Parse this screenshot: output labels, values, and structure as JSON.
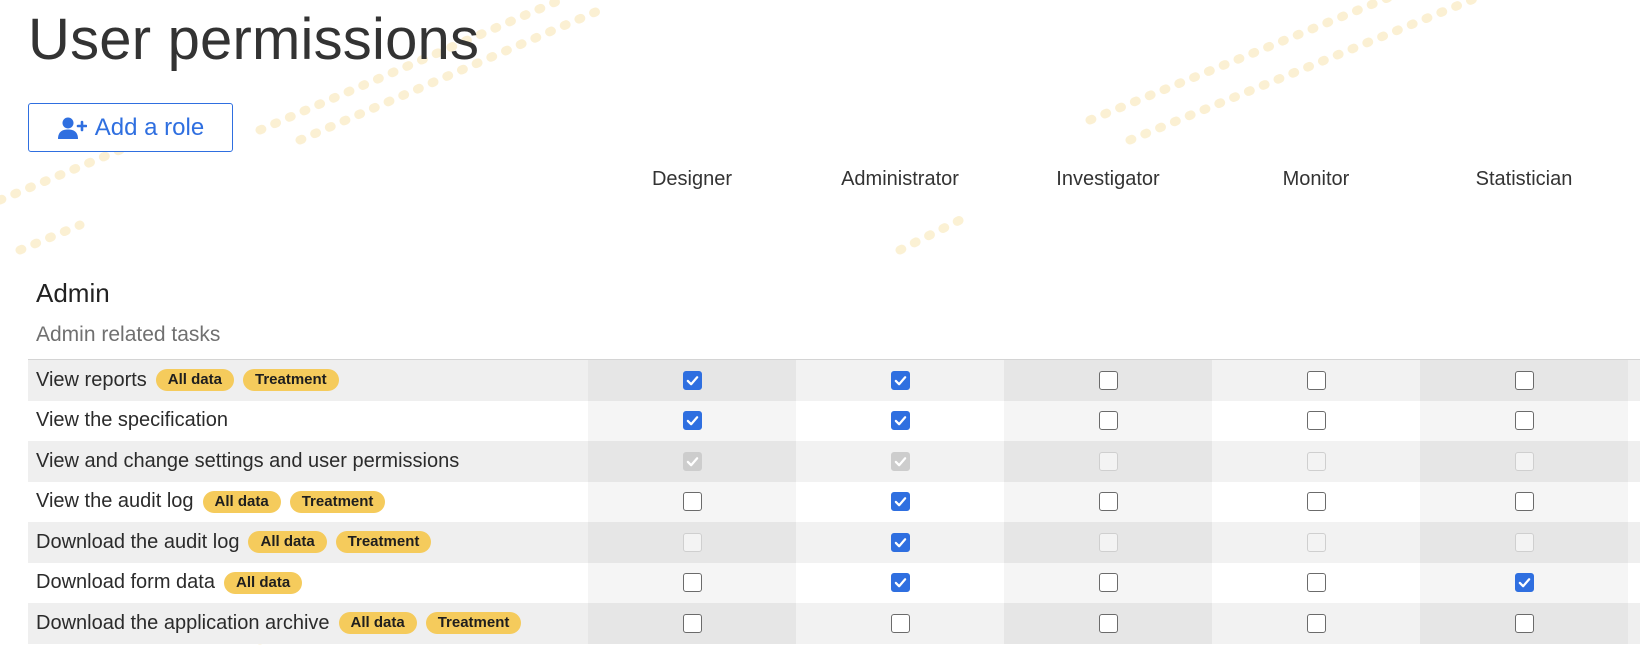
{
  "page": {
    "title": "User permissions",
    "add_role_label": "Add a role"
  },
  "roles": [
    "Designer",
    "Administrator",
    "Investigator",
    "Monitor",
    "Statistician"
  ],
  "section": {
    "title": "Admin",
    "subtitle": "Admin related tasks"
  },
  "permissions": [
    {
      "label": "View reports",
      "badges": [
        "All data",
        "Treatment"
      ],
      "checked": [
        true,
        true,
        false,
        false,
        false
      ],
      "disabled": [
        false,
        false,
        false,
        false,
        false
      ]
    },
    {
      "label": "View the specification",
      "badges": [],
      "checked": [
        true,
        true,
        false,
        false,
        false
      ],
      "disabled": [
        false,
        false,
        false,
        false,
        false
      ]
    },
    {
      "label": "View and change settings and user permissions",
      "badges": [],
      "checked": [
        true,
        true,
        false,
        false,
        false
      ],
      "disabled": [
        true,
        true,
        true,
        true,
        true
      ]
    },
    {
      "label": "View the audit log",
      "badges": [
        "All data",
        "Treatment"
      ],
      "checked": [
        false,
        true,
        false,
        false,
        false
      ],
      "disabled": [
        false,
        false,
        false,
        false,
        false
      ]
    },
    {
      "label": "Download the audit log",
      "badges": [
        "All data",
        "Treatment"
      ],
      "checked": [
        false,
        true,
        false,
        false,
        false
      ],
      "disabled": [
        true,
        false,
        true,
        true,
        true
      ]
    },
    {
      "label": "Download form data",
      "badges": [
        "All data"
      ],
      "checked": [
        false,
        true,
        false,
        false,
        true
      ],
      "disabled": [
        false,
        false,
        false,
        false,
        false
      ]
    },
    {
      "label": "Download the application archive",
      "badges": [
        "All data",
        "Treatment"
      ],
      "checked": [
        false,
        false,
        false,
        false,
        false
      ],
      "disabled": [
        false,
        false,
        false,
        false,
        false
      ]
    }
  ],
  "colors": {
    "accent": "#2f6fe0",
    "badge": "#f5cb5c",
    "watermark": "#fbefcf"
  },
  "icons": {
    "add_role": "user-plus-icon",
    "checkbox_mark": "checkmark-icon"
  }
}
